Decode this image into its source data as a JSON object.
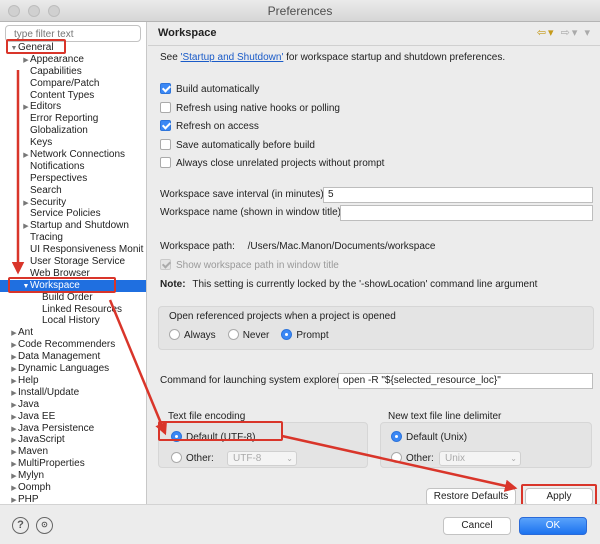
{
  "window": {
    "title": "Preferences"
  },
  "sidebar": {
    "filter_placeholder": "type filter text",
    "items": [
      {
        "label": "General",
        "level": 0,
        "twisty": "open"
      },
      {
        "label": "Appearance",
        "level": 1,
        "twisty": "closed"
      },
      {
        "label": "Capabilities",
        "level": 1,
        "twisty": ""
      },
      {
        "label": "Compare/Patch",
        "level": 1,
        "twisty": ""
      },
      {
        "label": "Content Types",
        "level": 1,
        "twisty": ""
      },
      {
        "label": "Editors",
        "level": 1,
        "twisty": "closed"
      },
      {
        "label": "Error Reporting",
        "level": 1,
        "twisty": ""
      },
      {
        "label": "Globalization",
        "level": 1,
        "twisty": ""
      },
      {
        "label": "Keys",
        "level": 1,
        "twisty": ""
      },
      {
        "label": "Network Connections",
        "level": 1,
        "twisty": "closed"
      },
      {
        "label": "Notifications",
        "level": 1,
        "twisty": ""
      },
      {
        "label": "Perspectives",
        "level": 1,
        "twisty": ""
      },
      {
        "label": "Search",
        "level": 1,
        "twisty": ""
      },
      {
        "label": "Security",
        "level": 1,
        "twisty": "closed"
      },
      {
        "label": "Service Policies",
        "level": 1,
        "twisty": ""
      },
      {
        "label": "Startup and Shutdown",
        "level": 1,
        "twisty": "closed"
      },
      {
        "label": "Tracing",
        "level": 1,
        "twisty": ""
      },
      {
        "label": "UI Responsiveness Monit",
        "level": 1,
        "twisty": ""
      },
      {
        "label": "User Storage Service",
        "level": 1,
        "twisty": ""
      },
      {
        "label": "Web Browser",
        "level": 1,
        "twisty": ""
      },
      {
        "label": "Workspace",
        "level": 1,
        "twisty": "open",
        "selected": true
      },
      {
        "label": "Build Order",
        "level": 2,
        "twisty": ""
      },
      {
        "label": "Linked Resources",
        "level": 2,
        "twisty": ""
      },
      {
        "label": "Local History",
        "level": 2,
        "twisty": ""
      },
      {
        "label": "Ant",
        "level": 0,
        "twisty": "closed"
      },
      {
        "label": "Code Recommenders",
        "level": 0,
        "twisty": "closed"
      },
      {
        "label": "Data Management",
        "level": 0,
        "twisty": "closed"
      },
      {
        "label": "Dynamic Languages",
        "level": 0,
        "twisty": "closed"
      },
      {
        "label": "Help",
        "level": 0,
        "twisty": "closed"
      },
      {
        "label": "Install/Update",
        "level": 0,
        "twisty": "closed"
      },
      {
        "label": "Java",
        "level": 0,
        "twisty": "closed"
      },
      {
        "label": "Java EE",
        "level": 0,
        "twisty": "closed"
      },
      {
        "label": "Java Persistence",
        "level": 0,
        "twisty": "closed"
      },
      {
        "label": "JavaScript",
        "level": 0,
        "twisty": "closed"
      },
      {
        "label": "Maven",
        "level": 0,
        "twisty": "closed"
      },
      {
        "label": "MultiProperties",
        "level": 0,
        "twisty": "closed"
      },
      {
        "label": "Mylyn",
        "level": 0,
        "twisty": "closed"
      },
      {
        "label": "Oomph",
        "level": 0,
        "twisty": "closed"
      },
      {
        "label": "PHP",
        "level": 0,
        "twisty": "closed"
      }
    ]
  },
  "page": {
    "title": "Workspace",
    "intro_prefix": "See ",
    "intro_link": "'Startup and Shutdown'",
    "intro_suffix": " for workspace startup and shutdown preferences.",
    "checkboxes": [
      {
        "label": "Build automatically",
        "checked": true
      },
      {
        "label": "Refresh using native hooks or polling",
        "checked": false
      },
      {
        "label": "Refresh on access",
        "checked": true
      },
      {
        "label": "Save automatically before build",
        "checked": false
      },
      {
        "label": "Always close unrelated projects without prompt",
        "checked": false
      }
    ],
    "save_interval_label": "Workspace save interval (in minutes):",
    "save_interval_value": "5",
    "name_label": "Workspace name (shown in window title):",
    "name_value": "",
    "path_label": "Workspace path:",
    "path_value": "/Users/Mac.Manon/Documents/workspace",
    "show_path_label": "Show workspace path in window title",
    "note_label": "Note:",
    "note_text": "This setting is currently locked by the '-showLocation' command line argument",
    "open_projects": {
      "title": "Open referenced projects when a project is opened",
      "options": [
        "Always",
        "Never",
        "Prompt"
      ],
      "selected": "Prompt"
    },
    "explorer_label": "Command for launching system explorer:",
    "explorer_value": "open -R \"${selected_resource_loc}\"",
    "encoding": {
      "title": "Text file encoding",
      "default_label": "Default (UTF-8)",
      "other_label": "Other:",
      "other_value": "UTF-8"
    },
    "delimiter": {
      "title": "New text file line delimiter",
      "default_label": "Default (Unix)",
      "other_label": "Other:",
      "other_value": "Unix"
    },
    "restore_label": "Restore Defaults",
    "apply_label": "Apply"
  },
  "footer": {
    "help_glyph": "?",
    "cancel_label": "Cancel",
    "ok_label": "OK"
  },
  "colors": {
    "selection": "#1f6fe0",
    "annotation": "#d9352a",
    "primary_button": "#1c72ef"
  }
}
